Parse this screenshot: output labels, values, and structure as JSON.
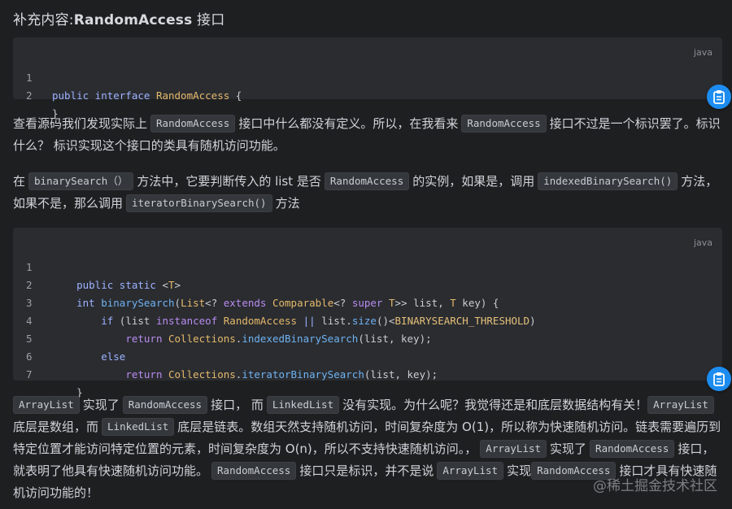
{
  "heading": {
    "prefix": "补充内容:",
    "bold": "RandomAccess",
    "suffix": " 接口"
  },
  "code1": {
    "lang": "java",
    "lines": [
      {
        "num": "1",
        "text": "public interface RandomAccess {"
      },
      {
        "num": "2",
        "text": "}"
      }
    ]
  },
  "para1": {
    "t1": "查看源码我们发现实际上",
    "c1": "RandomAccess",
    "t2": "接口中什么都没有定义。所以，在我看来",
    "c2": "RandomAccess",
    "t3": "接口不过是一个标识罢了。标识什么？ 标识实现这个接口的类具有随机访问功能。"
  },
  "para2": {
    "t1": "在",
    "c1": "binarySearch（）",
    "t2": "方法中，它要判断传入的 list 是否",
    "c2": "RandomAccess",
    "t3": "的实例，如果是，调用",
    "c3": "indexedBinarySearch()",
    "t4": "方法，如果不是，那么调用",
    "c4": "iteratorBinarySearch()",
    "t5": "方法"
  },
  "code2": {
    "lang": "java",
    "lines": [
      {
        "num": "1",
        "text": "    public static <T>"
      },
      {
        "num": "2",
        "text": "    int binarySearch(List<? extends Comparable<? super T>> list, T key) {"
      },
      {
        "num": "3",
        "text": "        if (list instanceof RandomAccess || list.size()<BINARYSEARCH_THRESHOLD)"
      },
      {
        "num": "4",
        "text": "            return Collections.indexedBinarySearch(list, key);"
      },
      {
        "num": "5",
        "text": "        else"
      },
      {
        "num": "6",
        "text": "            return Collections.iteratorBinarySearch(list, key);"
      },
      {
        "num": "7",
        "text": "    }"
      }
    ]
  },
  "para3": {
    "c1": "ArrayList",
    "t1": "实现了",
    "c2": "RandomAccess",
    "t2": "接口， 而",
    "c3": "LinkedList",
    "t3": "没有实现。为什么呢？我觉得还是和底层数据结构有关！",
    "c4": "ArrayList",
    "t4": "底层是数组，而",
    "c5": "LinkedList",
    "t5": "底层是链表。数组天然支持随机访问，时间复杂度为 O(1)，所以称为快速随机访问。链表需要遍历到特定位置才能访问特定位置的元素，时间复杂度为 O(n)，所以不支持快速随机访问。，",
    "c6": "ArrayList",
    "t6": "实现了",
    "c7": "RandomAccess",
    "t7": "接口，就表明了他具有快速随机访问功能。",
    "c8": "RandomAccess",
    "t8": "接口只是标识，并不是说",
    "c9": "ArrayList",
    "t9": "实现",
    "c10": "RandomAccess",
    "t10": "接口才具有快速随机访问功能的！"
  },
  "watermark": "@稀土掘金技术社区",
  "colors": {
    "background": "#1e1f21",
    "code_bg": "#2a2c30",
    "accent": "#1d8cf0"
  },
  "icons": {
    "copy": "clipboard-icon"
  }
}
